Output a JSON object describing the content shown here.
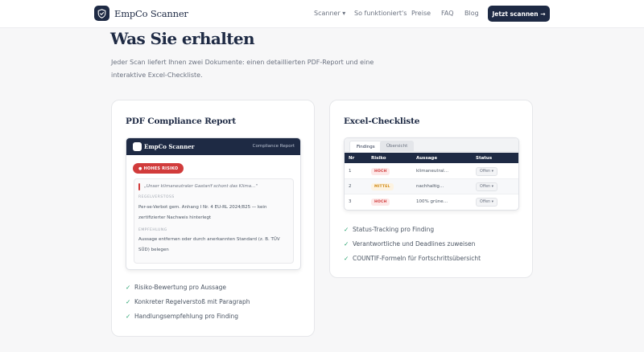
{
  "nav": {
    "brand": "EmpCo Scanner",
    "links": [
      "Scanner ▾",
      "So funktioniert's",
      "Preise",
      "FAQ",
      "Blog"
    ],
    "cta": "Jetzt scannen →"
  },
  "section": {
    "title": "Was Sie erhalten",
    "intro": "Jeder Scan liefert Ihnen zwei Dokumente: einen detaillierten PDF-Report und eine interaktive Excel-Checkliste."
  },
  "pdf_card": {
    "title": "PDF Compliance Report",
    "preview": {
      "brand": "EmpCo Scanner",
      "doc_label": "Compliance Report",
      "badge": "● HOHES RISIKO",
      "quote": "„Unser klimaneutraler Gastarif schont das Klima…\"",
      "violation_label": "REGELVERSTOSS",
      "violation_text": "Per-se-Verbot gem. Anhang I Nr. 4 EU-RL 2024/825 — kein zertifizierter Nachweis hinterlegt",
      "recommendation_label": "EMPFEHLUNG",
      "recommendation_text": "Aussage entfernen oder durch anerkannten Standard (z. B. TÜV SÜD) belegen"
    },
    "checklist": [
      "Risiko-Bewertung pro Aussage",
      "Konkreter Regelverstoß mit Paragraph",
      "Handlungsempfehlung pro Finding"
    ]
  },
  "excel_card": {
    "title": "Excel-Checkliste",
    "preview": {
      "tabs": [
        "Findings",
        "Übersicht"
      ],
      "columns": [
        "Nr",
        "Risiko",
        "Aussage",
        "Status"
      ],
      "rows": [
        {
          "nr": "1",
          "risk": "HOCH",
          "statement": "klimaneutral…",
          "status": "Offen ▾"
        },
        {
          "nr": "2",
          "risk": "MITTEL",
          "statement": "nachhaltig…",
          "status": "Offen ▾"
        },
        {
          "nr": "3",
          "risk": "HOCH",
          "statement": "100% grüne…",
          "status": "Offen ▾"
        }
      ]
    },
    "checklist": [
      "Status-Tracking pro Finding",
      "Verantwortliche und Deadlines zuweisen",
      "COUNTIF-Formeln für Fortschrittsübersicht"
    ]
  },
  "colors": {
    "primary": "#1e2a44",
    "danger": "#d13b3b",
    "warning": "#d08a18",
    "success": "#22a06b"
  },
  "icons": {
    "brand": "shield-check-icon",
    "check": "check-icon"
  }
}
